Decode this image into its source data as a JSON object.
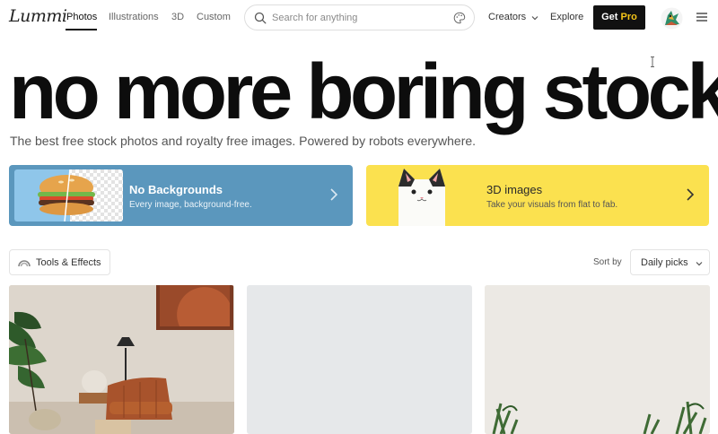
{
  "nav": {
    "logo": "Lummi",
    "tabs": [
      {
        "label": "Photos",
        "active": true
      },
      {
        "label": "Illustrations",
        "active": false
      },
      {
        "label": "3D",
        "active": false
      },
      {
        "label": "Custom",
        "active": false
      }
    ],
    "search_placeholder": "Search for anything",
    "creators_label": "Creators",
    "explore_label": "Explore",
    "get_label": "Get",
    "pro_label": "Pro"
  },
  "hero": {
    "headline": "no more boring stock",
    "subhead": "The best free stock photos and royalty free images. Powered by robots everywhere."
  },
  "promos": [
    {
      "title": "No Backgrounds",
      "description": "Every image, background-free.",
      "color": "#5b97bd"
    },
    {
      "title": "3D images",
      "description": "Take your visuals from flat to fab.",
      "color": "#fbe14f"
    }
  ],
  "toolbar": {
    "tools_label": "Tools & Effects",
    "sort_label": "Sort by",
    "sort_value": "Daily picks"
  },
  "colors": {
    "accent_dark": "#111111",
    "pro_yellow": "#f5c518"
  }
}
